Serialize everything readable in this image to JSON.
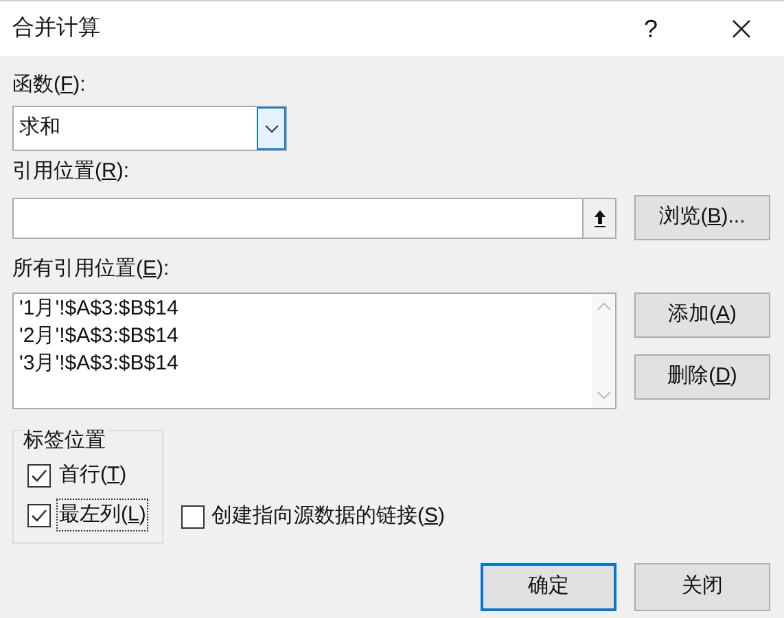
{
  "window": {
    "title": "合并计算",
    "help": "?"
  },
  "function": {
    "label": [
      "函数(",
      "F",
      "):"
    ],
    "value": "求和"
  },
  "reference": {
    "label": [
      "引用位置(",
      "R",
      "):"
    ]
  },
  "browse_button": [
    "浏览(",
    "B",
    ")..."
  ],
  "all_references": {
    "label": [
      "所有引用位置(",
      "E",
      "):"
    ],
    "items": [
      {
        "text": "'1月'!$A$3:$B$14",
        "selected": false
      },
      {
        "text": "'2月'!$A$3:$B$14",
        "selected": false
      },
      {
        "text": "'3月'!$A$3:$B$14",
        "selected": false
      }
    ]
  },
  "add_button": [
    "添加(",
    "A",
    ")"
  ],
  "delete_button": [
    "删除(",
    "D",
    ")"
  ],
  "label_position": {
    "title": "标签位置",
    "options": [
      {
        "label": [
          "首行(",
          "T",
          ")"
        ],
        "checked": true,
        "focused": false
      },
      {
        "label": [
          "最左列(",
          "L",
          ")"
        ],
        "checked": true,
        "focused": true
      }
    ]
  },
  "create_links": {
    "label": [
      "创建指向源数据的链接(",
      "S",
      ")"
    ],
    "checked": false
  },
  "ok_button": {
    "label": "确定",
    "default": true
  },
  "close_button": {
    "label": "关闭",
    "default": false
  }
}
